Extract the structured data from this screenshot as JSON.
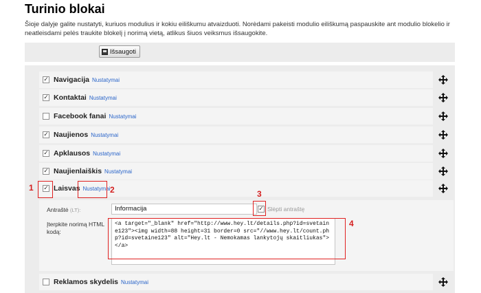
{
  "page": {
    "title": "Turinio blokai",
    "intro": "Šioje dalyje galite nustatyti, kuriuos modulius ir kokiu eiliškumu atvaizduoti. Norėdami pakeisti modulio eiliškumą paspauskite ant modulio blokelio ir neatleisdami pelės traukite blokelį į norimą vietą, atlikus šiuos veiksmus išsaugokite."
  },
  "toolbar": {
    "save_label": "Išsaugoti",
    "save_icon": "save-icon"
  },
  "settings_link": "Nustatymai",
  "move_icon": "move-arrows-icon",
  "modules": [
    {
      "name": "Navigacija",
      "checked": true
    },
    {
      "name": "Kontaktai",
      "checked": true
    },
    {
      "name": "Facebook fanai",
      "checked": false
    },
    {
      "name": "Naujienos",
      "checked": true
    },
    {
      "name": "Apklausos",
      "checked": true
    },
    {
      "name": "Naujienlaiškis",
      "checked": true
    },
    {
      "name": "Laisvas",
      "checked": true
    },
    {
      "name": "Reklamos skydelis",
      "checked": false
    }
  ],
  "expanded": {
    "title_label": "Antraštė",
    "title_lang": "(LT):",
    "title_value": "Informacija",
    "hide_title_label": "Slėpti antraštę",
    "hide_title_checked": true,
    "html_label": "Įterpkite norimą HTML kodą:",
    "html_value": "<a target=\"_blank\" href=\"http://www.hey.lt/details.php?id=svetaine123\"><img width=88 height=31 border=0 src=\"//www.hey.lt/count.php?id=svetaine123\" alt=\"Hey.lt - Nemokamas lankytojų skaitliukas\"></a>"
  },
  "annotations": [
    "1",
    "2",
    "3",
    "4"
  ],
  "colors": {
    "link": "#2a65c9",
    "annotation": "#e02020",
    "panel": "#ececec",
    "row": "#f4f4f4"
  }
}
